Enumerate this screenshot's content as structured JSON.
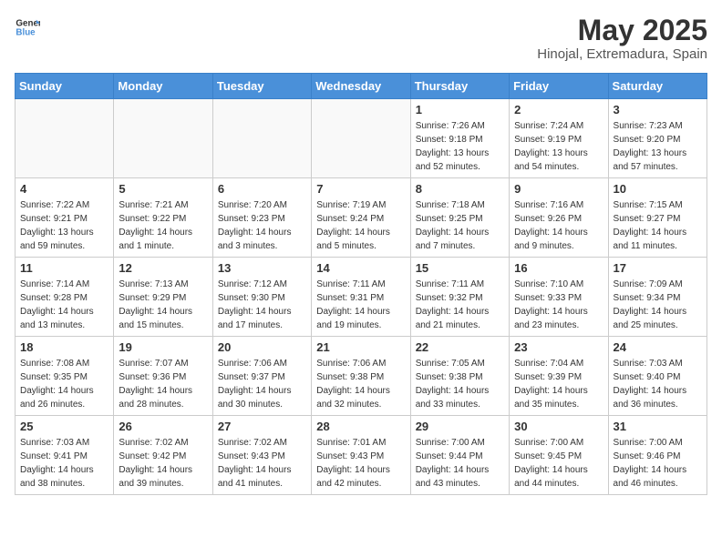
{
  "header": {
    "logo_general": "General",
    "logo_blue": "Blue",
    "title": "May 2025",
    "subtitle": "Hinojal, Extremadura, Spain"
  },
  "days_of_week": [
    "Sunday",
    "Monday",
    "Tuesday",
    "Wednesday",
    "Thursday",
    "Friday",
    "Saturday"
  ],
  "weeks": [
    [
      {
        "day": "",
        "info": ""
      },
      {
        "day": "",
        "info": ""
      },
      {
        "day": "",
        "info": ""
      },
      {
        "day": "",
        "info": ""
      },
      {
        "day": "1",
        "info": "Sunrise: 7:26 AM\nSunset: 9:18 PM\nDaylight: 13 hours\nand 52 minutes."
      },
      {
        "day": "2",
        "info": "Sunrise: 7:24 AM\nSunset: 9:19 PM\nDaylight: 13 hours\nand 54 minutes."
      },
      {
        "day": "3",
        "info": "Sunrise: 7:23 AM\nSunset: 9:20 PM\nDaylight: 13 hours\nand 57 minutes."
      }
    ],
    [
      {
        "day": "4",
        "info": "Sunrise: 7:22 AM\nSunset: 9:21 PM\nDaylight: 13 hours\nand 59 minutes."
      },
      {
        "day": "5",
        "info": "Sunrise: 7:21 AM\nSunset: 9:22 PM\nDaylight: 14 hours\nand 1 minute."
      },
      {
        "day": "6",
        "info": "Sunrise: 7:20 AM\nSunset: 9:23 PM\nDaylight: 14 hours\nand 3 minutes."
      },
      {
        "day": "7",
        "info": "Sunrise: 7:19 AM\nSunset: 9:24 PM\nDaylight: 14 hours\nand 5 minutes."
      },
      {
        "day": "8",
        "info": "Sunrise: 7:18 AM\nSunset: 9:25 PM\nDaylight: 14 hours\nand 7 minutes."
      },
      {
        "day": "9",
        "info": "Sunrise: 7:16 AM\nSunset: 9:26 PM\nDaylight: 14 hours\nand 9 minutes."
      },
      {
        "day": "10",
        "info": "Sunrise: 7:15 AM\nSunset: 9:27 PM\nDaylight: 14 hours\nand 11 minutes."
      }
    ],
    [
      {
        "day": "11",
        "info": "Sunrise: 7:14 AM\nSunset: 9:28 PM\nDaylight: 14 hours\nand 13 minutes."
      },
      {
        "day": "12",
        "info": "Sunrise: 7:13 AM\nSunset: 9:29 PM\nDaylight: 14 hours\nand 15 minutes."
      },
      {
        "day": "13",
        "info": "Sunrise: 7:12 AM\nSunset: 9:30 PM\nDaylight: 14 hours\nand 17 minutes."
      },
      {
        "day": "14",
        "info": "Sunrise: 7:11 AM\nSunset: 9:31 PM\nDaylight: 14 hours\nand 19 minutes."
      },
      {
        "day": "15",
        "info": "Sunrise: 7:11 AM\nSunset: 9:32 PM\nDaylight: 14 hours\nand 21 minutes."
      },
      {
        "day": "16",
        "info": "Sunrise: 7:10 AM\nSunset: 9:33 PM\nDaylight: 14 hours\nand 23 minutes."
      },
      {
        "day": "17",
        "info": "Sunrise: 7:09 AM\nSunset: 9:34 PM\nDaylight: 14 hours\nand 25 minutes."
      }
    ],
    [
      {
        "day": "18",
        "info": "Sunrise: 7:08 AM\nSunset: 9:35 PM\nDaylight: 14 hours\nand 26 minutes."
      },
      {
        "day": "19",
        "info": "Sunrise: 7:07 AM\nSunset: 9:36 PM\nDaylight: 14 hours\nand 28 minutes."
      },
      {
        "day": "20",
        "info": "Sunrise: 7:06 AM\nSunset: 9:37 PM\nDaylight: 14 hours\nand 30 minutes."
      },
      {
        "day": "21",
        "info": "Sunrise: 7:06 AM\nSunset: 9:38 PM\nDaylight: 14 hours\nand 32 minutes."
      },
      {
        "day": "22",
        "info": "Sunrise: 7:05 AM\nSunset: 9:38 PM\nDaylight: 14 hours\nand 33 minutes."
      },
      {
        "day": "23",
        "info": "Sunrise: 7:04 AM\nSunset: 9:39 PM\nDaylight: 14 hours\nand 35 minutes."
      },
      {
        "day": "24",
        "info": "Sunrise: 7:03 AM\nSunset: 9:40 PM\nDaylight: 14 hours\nand 36 minutes."
      }
    ],
    [
      {
        "day": "25",
        "info": "Sunrise: 7:03 AM\nSunset: 9:41 PM\nDaylight: 14 hours\nand 38 minutes."
      },
      {
        "day": "26",
        "info": "Sunrise: 7:02 AM\nSunset: 9:42 PM\nDaylight: 14 hours\nand 39 minutes."
      },
      {
        "day": "27",
        "info": "Sunrise: 7:02 AM\nSunset: 9:43 PM\nDaylight: 14 hours\nand 41 minutes."
      },
      {
        "day": "28",
        "info": "Sunrise: 7:01 AM\nSunset: 9:43 PM\nDaylight: 14 hours\nand 42 minutes."
      },
      {
        "day": "29",
        "info": "Sunrise: 7:00 AM\nSunset: 9:44 PM\nDaylight: 14 hours\nand 43 minutes."
      },
      {
        "day": "30",
        "info": "Sunrise: 7:00 AM\nSunset: 9:45 PM\nDaylight: 14 hours\nand 44 minutes."
      },
      {
        "day": "31",
        "info": "Sunrise: 7:00 AM\nSunset: 9:46 PM\nDaylight: 14 hours\nand 46 minutes."
      }
    ]
  ]
}
